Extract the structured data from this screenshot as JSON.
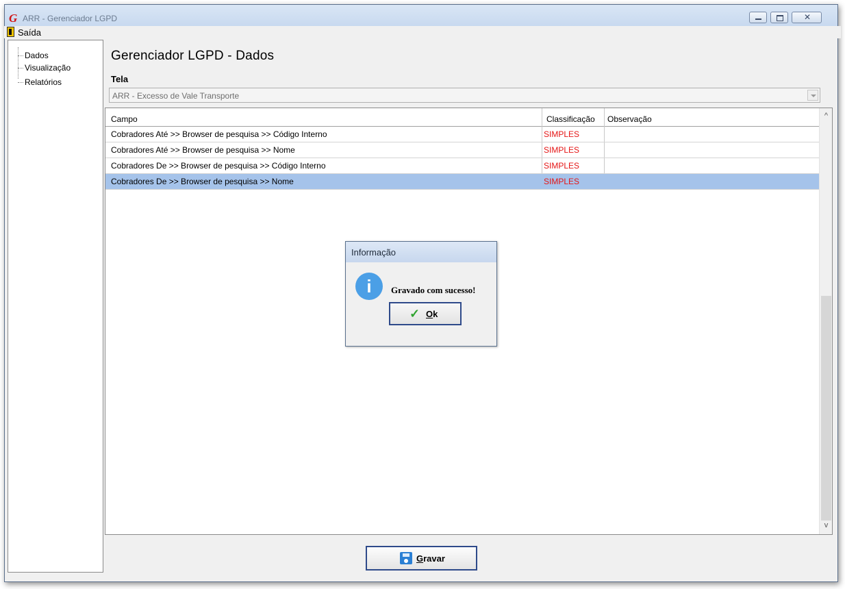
{
  "window": {
    "title": "ARR - Gerenciador LGPD",
    "app_icon": "G"
  },
  "menu": {
    "exit_label": "Saída"
  },
  "sidebar": {
    "items": [
      {
        "label": "Dados"
      },
      {
        "label": "Visualização"
      },
      {
        "label": "Relatórios"
      }
    ]
  },
  "main": {
    "title": "Gerenciador LGPD - Dados",
    "tela_label": "Tela",
    "tela_value": "ARR - Excesso de Vale Transporte"
  },
  "grid": {
    "headers": [
      "Campo",
      "Classificação",
      "Observação"
    ],
    "rows": [
      {
        "campo": "Cobradores Até >> Browser de pesquisa >> Código Interno",
        "classificacao": "SIMPLES",
        "observacao": ""
      },
      {
        "campo": "Cobradores Até >> Browser de pesquisa >> Nome",
        "classificacao": "SIMPLES",
        "observacao": ""
      },
      {
        "campo": "Cobradores De >> Browser de pesquisa >> Código Interno",
        "classificacao": "SIMPLES",
        "observacao": ""
      },
      {
        "campo": "Cobradores De >> Browser de pesquisa >> Nome",
        "classificacao": "SIMPLES",
        "observacao": "",
        "selected": true
      }
    ]
  },
  "dialog": {
    "title": "Informação",
    "icon_letter": "i",
    "message": "Gravado com sucesso!",
    "ok_mnemonic": "O",
    "ok_rest": "k"
  },
  "footer": {
    "gravar_mnemonic": "G",
    "gravar_rest": "ravar"
  },
  "colors": {
    "classification_text": "#e51515",
    "selected_row": "#a5c3ea",
    "info_icon": "#4b9fe6"
  }
}
